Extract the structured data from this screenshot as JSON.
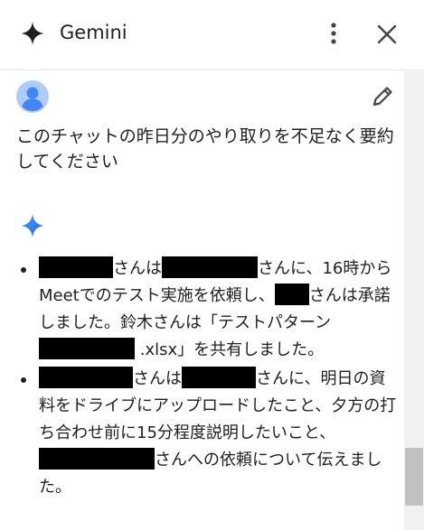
{
  "header": {
    "title": "Gemini"
  },
  "user_message": {
    "text": "このチャットの昨日分のやり取りを不足なく要約してください"
  },
  "response": {
    "items": [
      {
        "seg1": "さんは",
        "seg2": "さんに、16時からMeetでのテスト実施を依頼し、",
        "seg3": "さんは承諾しました。鈴木さんは「テストパターン",
        "seg4": ".xlsx」を共有しました。"
      },
      {
        "seg1": "さんは",
        "seg2": "さんに、明日の資料をドライブにアップロードしたこと、夕方の打ち合わせ前に15分程度説明したいこと、",
        "seg3": "さんへの依頼について伝えました。"
      }
    ]
  },
  "colors": {
    "accent": "#1a73e8",
    "avatar_bg": "#aecbfa",
    "avatar_fg": "#4285f4"
  }
}
